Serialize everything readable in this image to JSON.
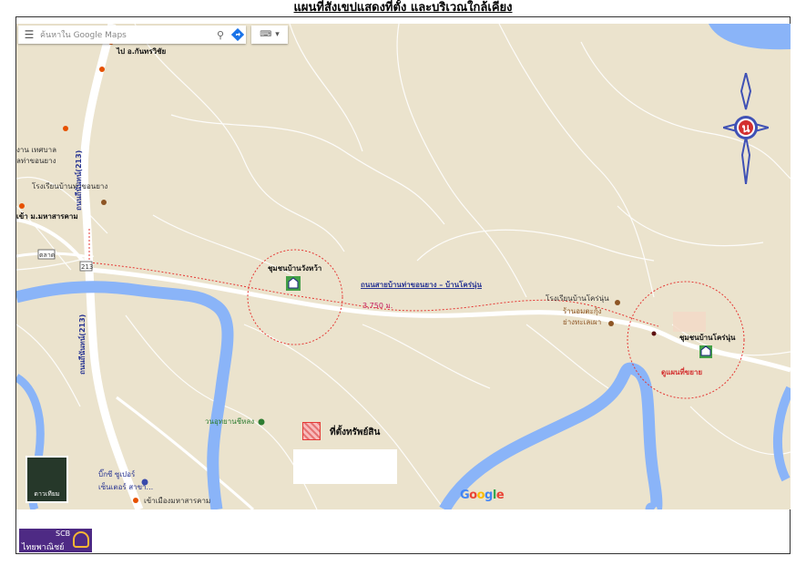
{
  "title": "แผนที่สังเขปแสดงที่ตั้ง และบริเวณใกล้เคียง",
  "search": {
    "placeholder": "ค้นหาใน Google Maps",
    "menu_icon": "menu-icon",
    "search_icon": "search-icon",
    "directions_icon": "directions-icon"
  },
  "keyboard_icon": "keyboard-icon",
  "satellite_label": "ดาวเทียม",
  "google_logo": "Google",
  "labels": {
    "to_kantharawichai": "ไป อ.กันทรวิชัย",
    "municipality": "งาน เทศบาล",
    "municipality2": "ลท่าขอนยาง",
    "school_tha_khon_yang": "โรงเรียนบ้านท่าขอนยาง",
    "entrance_msu": "เข้า ม.มหาสารคาม",
    "road_213_a": "ถนนถีนันทน์(213)",
    "road_213_b": "ถนนถีนันทน์(213)",
    "route_213": "213",
    "shield_badge": "ตลาด",
    "community_wang_wa": "ชุมชนบ้านวังหว้า",
    "road_name": "ถนนสายบ้านท่าขอนยาง – บ้านโคร่นุ่น",
    "distance": "3,750 ม.",
    "school_khrai_nun": "โรงเรียนบ้านโคร่นุ่น",
    "shop_1": "ร้านอมตะกุ้ง",
    "shop_2": "ย่างทะเลเผา",
    "community_khrai_nun": "ชุมชนบ้านโคร่นุ่น",
    "map_note": "ดูแผนที่ขยาย",
    "forest_park": "วนอุทยานชีหลง",
    "big_c_1": "บิ๊กซี ซูเปอร์",
    "big_c_2": "เซ็นเตอร์ สาขา...",
    "msu_entrance_bottom": "เข้าเมืองมหาสารคาม"
  },
  "legend": {
    "label": "ที่ตั้งทรัพย์สิน",
    "color": "#e57373"
  },
  "compass_letter": "น",
  "bank": {
    "name": "SCB",
    "thai": "ไทยพาณิชย์"
  },
  "colors": {
    "water": "#8ab4f8",
    "land": "#ebe3cd",
    "road": "#ffffff",
    "route": "#e53935",
    "bank": "#4e2a84",
    "compass": "#3f51b5"
  }
}
